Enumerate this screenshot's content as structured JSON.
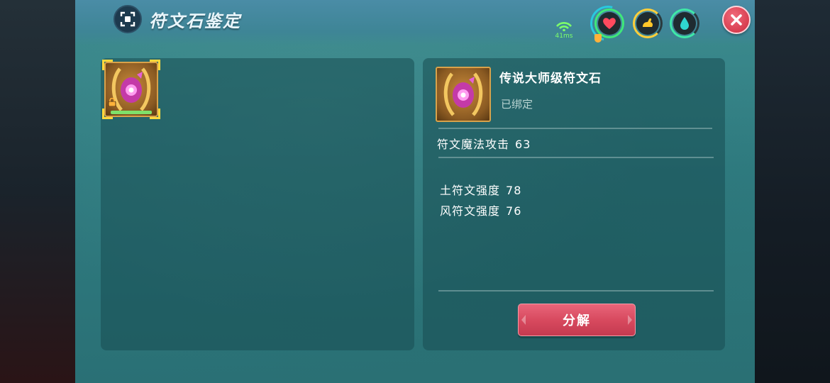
{
  "header": {
    "title": "符文石鉴定",
    "title_icon": "scan-frame-icon"
  },
  "hud": {
    "ping": "41ms",
    "signal_icon": "wifi-signal-icon",
    "gauges": [
      {
        "name": "health",
        "icon": "heart-icon",
        "ring_color": "#3fe87a",
        "inner_color": "#ff4a5e"
      },
      {
        "name": "stamina",
        "icon": "arm-icon",
        "ring_color": "#ffcf3a",
        "inner_color": "#ffc629"
      },
      {
        "name": "water",
        "icon": "water-drop-icon",
        "ring_color": "#3fe8a8",
        "inner_color": "#2fd6d0"
      }
    ]
  },
  "inventory": {
    "slots": [
      {
        "item": "传说大师级符文石",
        "selected": true,
        "locked": true,
        "progress": 1.0
      }
    ]
  },
  "detail": {
    "name": "传说大师级符文石",
    "binding": "已绑定",
    "primary_stat": {
      "label": "符文魔法攻击",
      "value": "63"
    },
    "secondary_stats": [
      {
        "label": "土符文强度",
        "value": "78"
      },
      {
        "label": "风符文强度",
        "value": "76"
      }
    ],
    "action_label": "分解"
  },
  "colors": {
    "accent_gold": "#ffd93c",
    "button_red": "#d84a5f",
    "close_red": "#d83e50"
  }
}
